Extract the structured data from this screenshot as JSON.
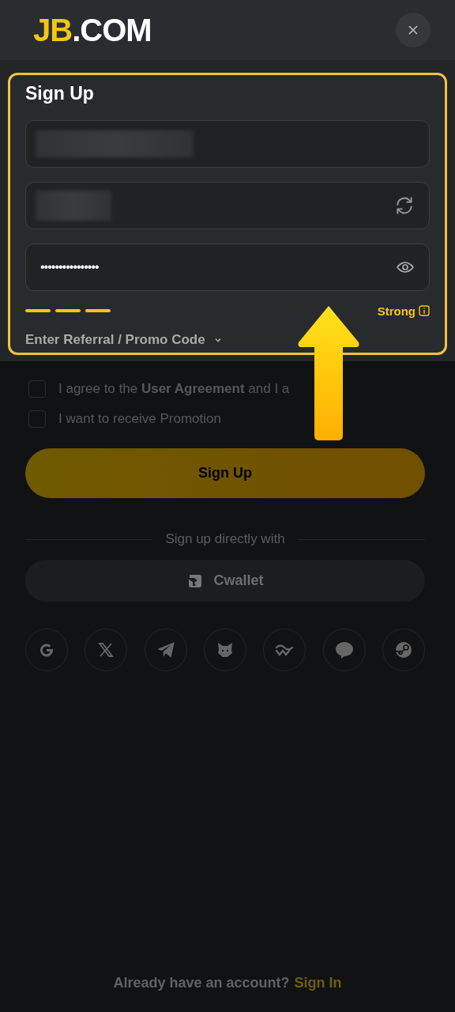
{
  "header": {
    "logo_accent": "JB",
    "logo_rest": ".COM"
  },
  "form": {
    "title": "Sign Up",
    "fields": [
      {
        "kind": "text",
        "redacted": true
      },
      {
        "kind": "refresh",
        "redacted": true
      },
      {
        "kind": "password",
        "redacted": false,
        "value": "••••••••••••••••"
      }
    ],
    "strength_bars": [
      {
        "filled": true
      },
      {
        "filled": true
      },
      {
        "filled": true
      }
    ],
    "strength_label": "Strong",
    "referral": {
      "label": "Enter Referral / Promo Code",
      "expanded": false
    }
  },
  "checkboxes": [
    {
      "label": "I agree to the **User Agreement** and I a",
      "checked": false
    },
    {
      "label": "I want to receive Promotion",
      "checked": false
    }
  ],
  "submit": "Sign Up",
  "divider": "Sign up directly with",
  "wallet_button": "Cwallet",
  "social": [
    {
      "kind": "google"
    },
    {
      "kind": "x"
    },
    {
      "kind": "telegram"
    },
    {
      "kind": "fox"
    },
    {
      "kind": "wave"
    },
    {
      "kind": "line"
    },
    {
      "kind": "steam"
    }
  ],
  "footer": {
    "text": "Already have an account?",
    "link": "Sign In"
  }
}
